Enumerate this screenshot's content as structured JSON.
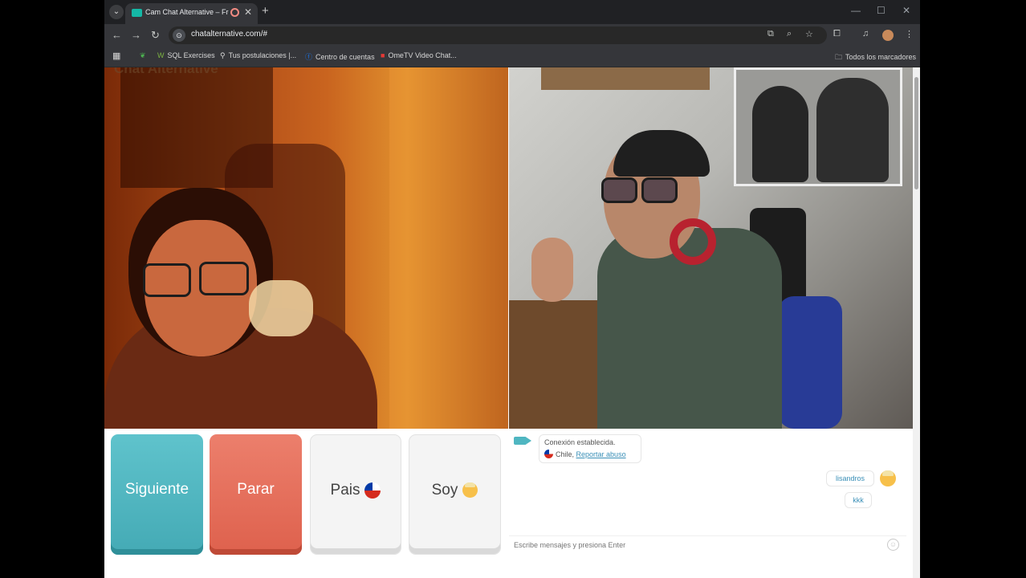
{
  "browser": {
    "tab_title": "Cam Chat Alternative – Fre",
    "tab_close": "✕",
    "new_tab": "+",
    "url": "chatalternative.com/#",
    "window_controls": {
      "minimize": "—",
      "maximize": "☐",
      "close": "✕"
    },
    "nav": {
      "back": "←",
      "forward": "→",
      "reload": "↻"
    }
  },
  "bookmarks": {
    "items": [
      {
        "label": "SQL Exercises"
      },
      {
        "label": "Tus postulaciones |..."
      },
      {
        "label": "Centro de cuentas"
      },
      {
        "label": "OmeTV Video Chat..."
      }
    ],
    "all_bookmarks": "Todos los marcadores"
  },
  "page": {
    "logo": "Chat Alternative"
  },
  "controls": {
    "next_label": "Siguiente",
    "stop_label": "Parar",
    "country_label": "Pais",
    "gender_label": "Soy"
  },
  "chat": {
    "system_line1": "Conexión establecida.",
    "system_country": "Chile,",
    "system_report": "Reportar abuso",
    "messages": [
      {
        "text": "lisandros"
      },
      {
        "text": "kkk"
      }
    ],
    "input_placeholder": "Escribe mensajes y presiona Enter"
  },
  "icons": {
    "site_icon": "⊙",
    "smile": "☺"
  },
  "colors": {
    "next_button": "#4fb6c1",
    "stop_button": "#e26a56",
    "link": "#3a8fb7",
    "browser_dark": "#202124"
  }
}
